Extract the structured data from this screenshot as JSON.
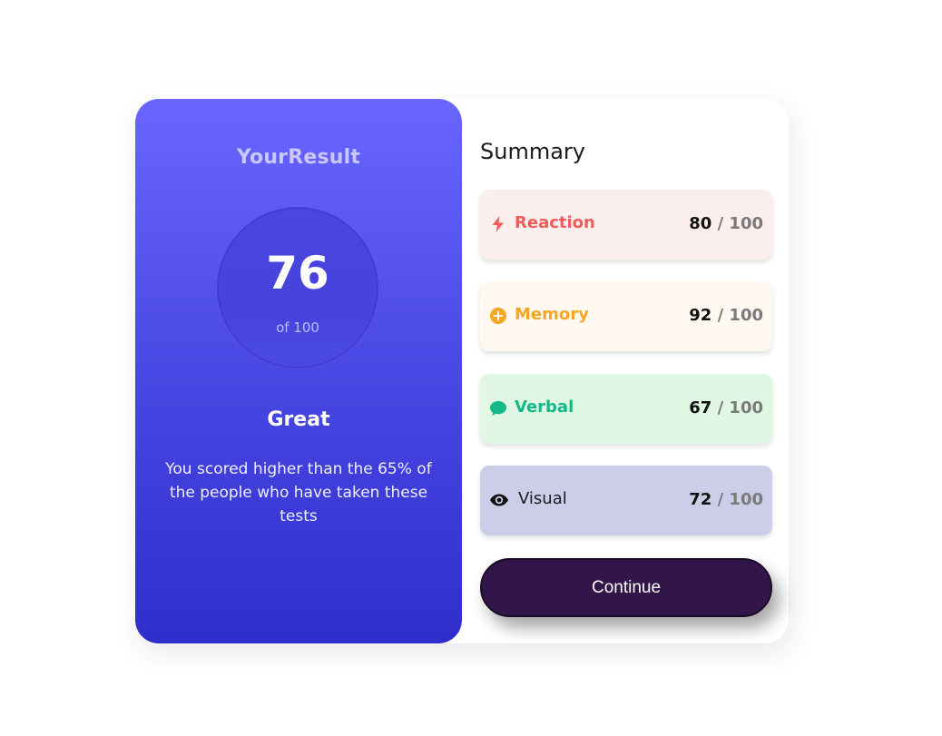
{
  "result": {
    "title": "YourResult",
    "score": "76",
    "score_total": "of 100",
    "verdict": "Great",
    "description": "You scored higher than the 65% of the people who have taken these tests"
  },
  "summary": {
    "title": "Summary",
    "items": [
      {
        "label": "Reaction",
        "score": "80",
        "max": "/ 100",
        "icon": "lightning-icon",
        "color": "#f25c5c",
        "bg": "#fbefee"
      },
      {
        "label": "Memory",
        "score": "92",
        "max": "/ 100",
        "icon": "plus-circle-icon",
        "color": "#f5a623",
        "bg": "#fff8f0"
      },
      {
        "label": "Verbal",
        "score": "67",
        "max": "/ 100",
        "icon": "chat-bubble-icon",
        "color": "#14b98a",
        "bg": "#e0f7e3"
      },
      {
        "label": "Visual",
        "score": "72",
        "max": "/ 100",
        "icon": "eye-icon",
        "color": "#1a1a1a",
        "bg": "#cccde8"
      }
    ]
  },
  "continue_label": "Continue"
}
